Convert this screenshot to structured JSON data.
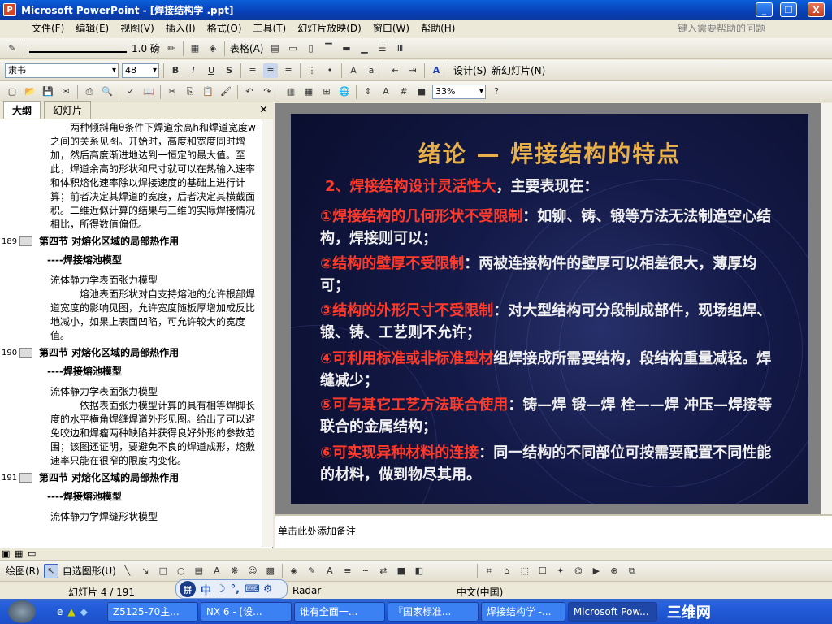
{
  "titlebar": {
    "title": "Microsoft PowerPoint - [焊接结构学 .ppt]",
    "min": "_",
    "restore": "❐",
    "close": "X"
  },
  "menu": {
    "items": [
      "文件(F)",
      "编辑(E)",
      "视图(V)",
      "插入(I)",
      "格式(O)",
      "工具(T)",
      "幻灯片放映(D)",
      "窗口(W)",
      "帮助(H)"
    ],
    "help_placeholder": "键入需要帮助的问题"
  },
  "toolbar1": {
    "line_weight": "1.0 磅",
    "table_label": "表格(A)"
  },
  "toolbar2": {
    "font": "隶书",
    "size": "48",
    "design": "设计(S)",
    "new_slide": "新幻灯片(N)"
  },
  "toolbar3": {
    "zoom": "33%"
  },
  "tabs": {
    "outline": "大纲",
    "slides": "幻灯片"
  },
  "outline": {
    "para": "两种倾斜角θ条件下焊道余高h和焊道宽度w之间的关系见图。开始时，高度和宽度同时增加，然后高度渐进地达到一恒定的最大值。至此，焊道余高的形状和尺寸就可以在热输入速率和体积熔化速率除以焊接速度的基础上进行计算；前者决定其焊道的宽度，后者决定其横截面积。二维近似计算的结果与三维的实际焊接情况相比，所得数值偏低。",
    "slides": [
      {
        "num": "189",
        "title": "第四节  对熔化区域的局部热作用",
        "sub": "----焊接熔池模型",
        "body1": "流体静力学表面张力模型",
        "body2": "熔池表面形状对自支持熔池的允许根部焊道宽度的影响见图，允许宽度随板厚增加成反比地减小，如果上表面凹陷，可允许较大的宽度值。"
      },
      {
        "num": "190",
        "title": "第四节  对熔化区域的局部热作用",
        "sub": "----焊接熔池模型",
        "body1": "流体静力学表面张力模型",
        "body2": "依据表面张力模型计算的具有相等焊脚长度的水平横角焊缝焊道外形见图。给出了可以避免咬边和焊瘤两种缺陷并获得良好外形的参数范围；该图还证明，要避免不良的焊道成形，熔敷速率只能在很窄的限度内变化。"
      },
      {
        "num": "191",
        "title": "第四节  对熔化区域的局部热作用",
        "sub": "----焊接熔池模型",
        "body1": "流体静力学焊缝形状模型"
      }
    ]
  },
  "slide": {
    "title": "绪论  —  焊接结构的特点",
    "heading_red": "2、焊接结构设计灵活性大",
    "heading_rest": "，主要表现在：",
    "items": [
      {
        "red": "①焊接结构的几何形状不受限制",
        "rest": "：如铆、铸、锻等方法无法制造空心结构，焊接则可以；"
      },
      {
        "red": "②结构的壁厚不受限制",
        "rest": "：两被连接构件的壁厚可以相差很大，薄厚均可；"
      },
      {
        "red": "③结构的外形尺寸不受限制",
        "rest": "：对大型结构可分段制成部件，现场组焊、锻、铸、工艺则不允许；"
      },
      {
        "red": "④可利用标准或非标准型材",
        "rest": "组焊接成所需要结构，段结构重量减轻。焊缝减少；"
      },
      {
        "red": "⑤可与其它工艺方法联合使用",
        "rest": "：铸—焊    锻—焊   栓——焊     冲压—焊接等联合的金属结构；"
      },
      {
        "red": "⑥可实现异种材料的连接",
        "rest": "：同一结构的不同部位可按需要配置不同性能的材料，做到物尽其用。"
      }
    ]
  },
  "notes": {
    "placeholder": "单击此处添加备注"
  },
  "drawbar": {
    "draw": "绘图(R)",
    "autoshape": "自选图形(U)"
  },
  "status": {
    "slide": "幻灯片 4 / 191",
    "design": "Radar",
    "lang": "中文(中国)"
  },
  "ime": {
    "mode": "中"
  },
  "taskbar": {
    "tasks": [
      "Z5125-70主...",
      "NX 6 - [设...",
      "谁有全面一...",
      "『国家标准...",
      "焊接结构学 -...",
      "Microsoft Pow..."
    ],
    "logo": "三维网"
  }
}
